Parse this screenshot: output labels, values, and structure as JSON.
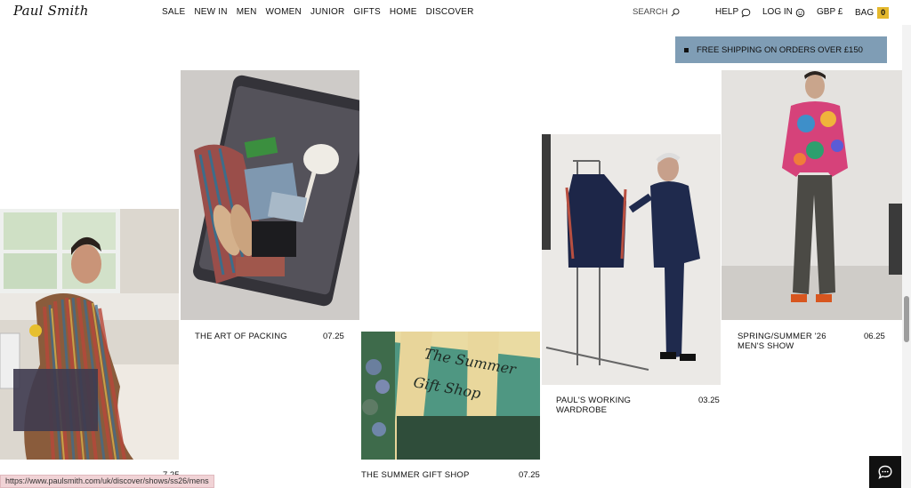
{
  "header": {
    "logo": "Paul Smith",
    "nav": [
      "SALE",
      "NEW IN",
      "MEN",
      "WOMEN",
      "JUNIOR",
      "GIFTS",
      "HOME",
      "DISCOVER"
    ],
    "search_label": "SEARCH",
    "help_label": "HELP",
    "login_label": "LOG IN",
    "currency_label": "GBP £",
    "bag_label": "BAG",
    "bag_count": "0"
  },
  "banner": {
    "text": "FREE SHIPPING ON ORDERS OVER £150",
    "color": "#7f9db5"
  },
  "articles": [
    {
      "title": "",
      "date": "7.25",
      "image": "man-in-striped-robe"
    },
    {
      "title": "THE ART OF PACKING",
      "date": "07.25",
      "image": "open-suitcase"
    },
    {
      "title": "THE SUMMER GIFT SHOP",
      "date": "07.25",
      "image": "summer-gift-shop-storefront"
    },
    {
      "title_line1": "PAUL'S WORKING",
      "title_line2": "WARDROBE",
      "date": "03.25",
      "image": "paul-at-clothing-rail"
    },
    {
      "title_line1": "SPRING/SUMMER '26",
      "title_line2": "MEN'S SHOW",
      "date": "06.25",
      "image": "runway-model"
    }
  ],
  "shop_sign": {
    "line1": "The Summer",
    "line2": "Gift Shop"
  },
  "status_url": "https://www.paulsmith.com/uk/discover/shows/ss26/mens",
  "colors": {
    "bag_badge": "#e5b82c",
    "chat_button": "#111111"
  }
}
